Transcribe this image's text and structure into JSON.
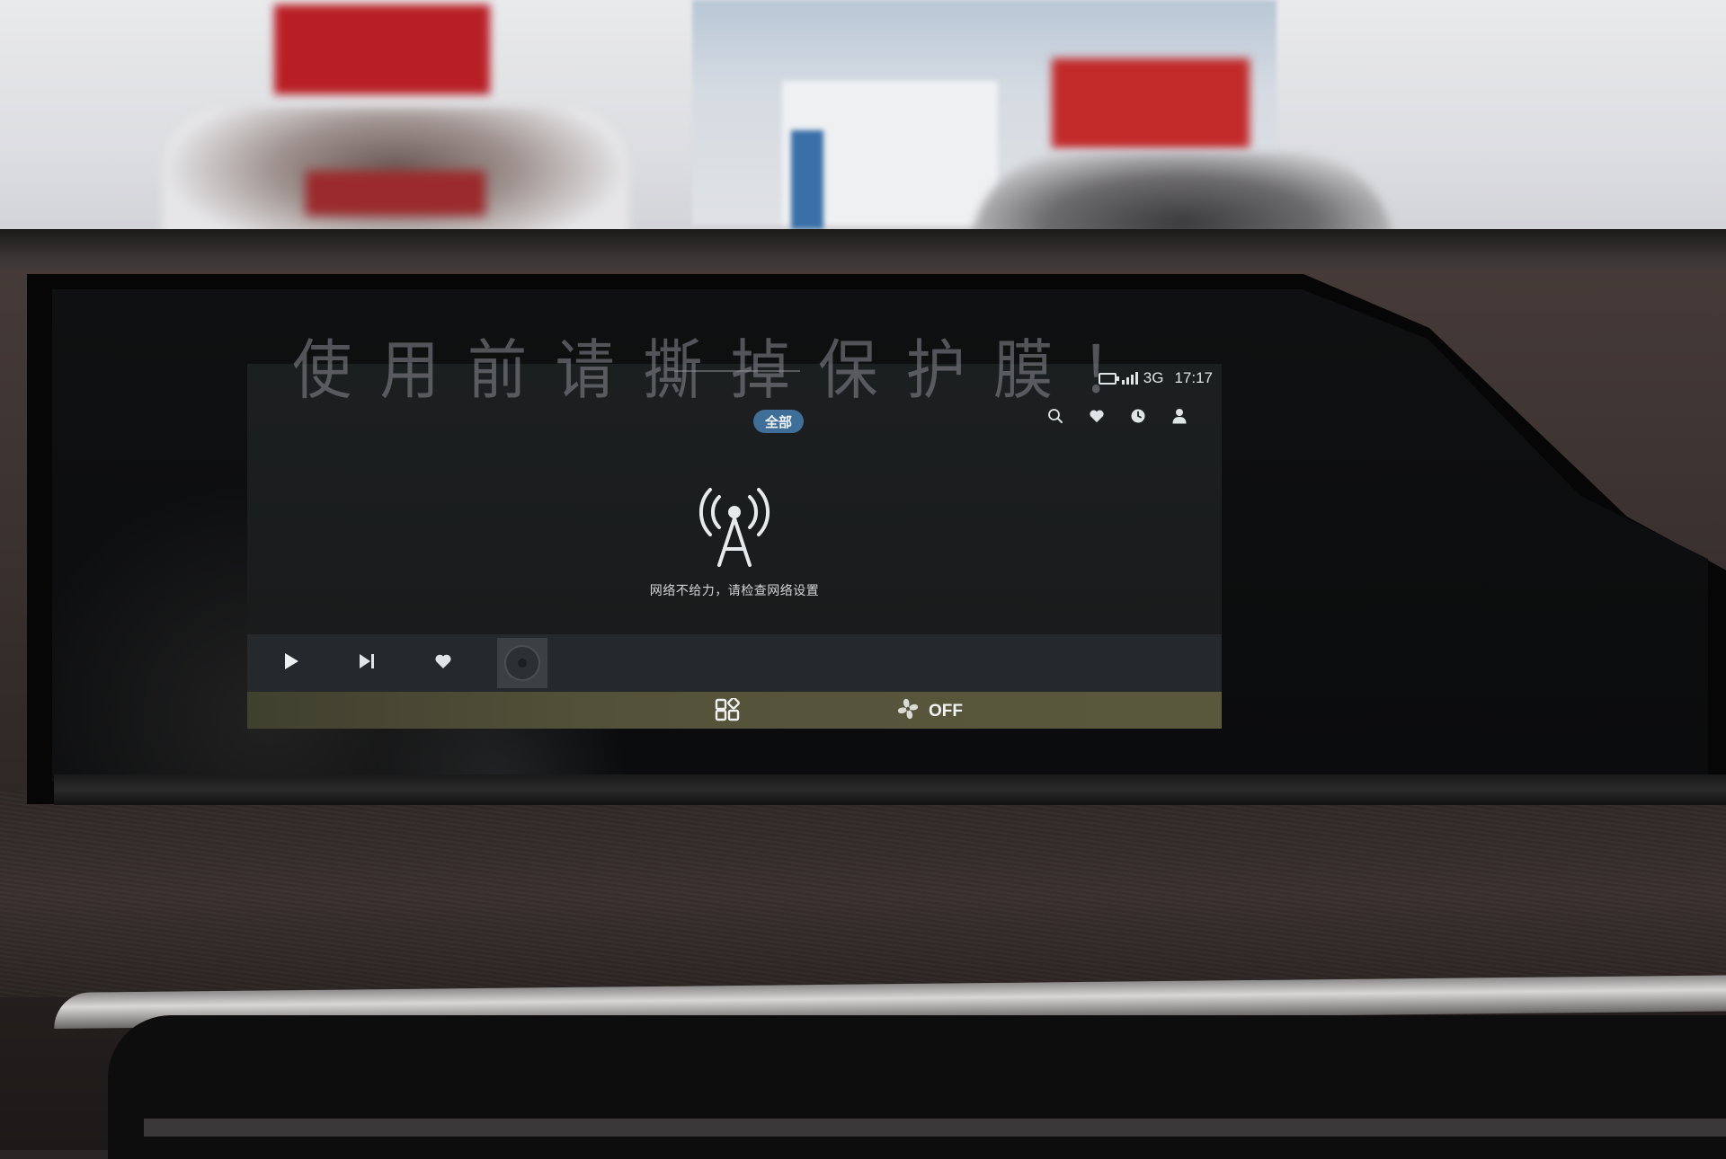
{
  "film_warning": "使用前请撕掉保护膜！",
  "status_bar": {
    "network": "3G",
    "time": "17:17"
  },
  "header": {
    "category_pill": "全部",
    "icons": [
      "search-icon",
      "heart-icon",
      "clock-icon",
      "user-icon"
    ]
  },
  "empty_state": {
    "icon": "signal-tower-icon",
    "message": "网络不给力，请检查网络设置"
  },
  "player": {
    "controls": [
      "play-icon",
      "skip-next-icon",
      "heart-icon"
    ],
    "album_art_icon": "disc-icon"
  },
  "bottom_bar": {
    "apps_icon": "app-grid-icon",
    "fan_icon": "fan-icon",
    "fan_label": "OFF"
  },
  "colors": {
    "screen_bg": "#1b1e1f",
    "accent": "#3f6f98",
    "player_bar": "#25292b",
    "bottom_bar": "#54533a",
    "text": "#dfe4e7"
  }
}
